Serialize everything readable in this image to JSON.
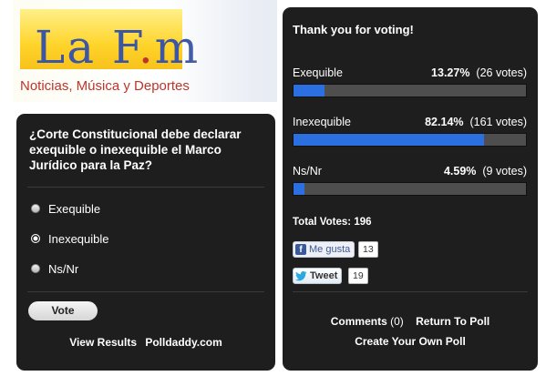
{
  "banner": {
    "logo_main": "La F",
    "logo_dot": ".",
    "logo_end": "m",
    "tagline": "Noticias, Música y Deportes"
  },
  "poll": {
    "question": "¿Corte Constitucional debe declarar exequible o inexequible el Marco Jurídico para la Paz?",
    "options": [
      {
        "label": "Exequible"
      },
      {
        "label": "Inexequible"
      },
      {
        "label": "Ns/Nr"
      }
    ],
    "vote_label": "Vote",
    "view_results_label": "View Results",
    "polldaddy_label": "Polldaddy.com"
  },
  "results": {
    "thanks": "Thank you for voting!",
    "items": [
      {
        "label": "Exequible",
        "percent_text": "13.27%",
        "votes_text": "(26 votes)",
        "percent": 13.27
      },
      {
        "label": "Inexequible",
        "percent_text": "82.14%",
        "votes_text": "(161 votes)",
        "percent": 82.14
      },
      {
        "label": "Ns/Nr",
        "percent_text": "4.59%",
        "votes_text": "(9 votes)",
        "percent": 4.59
      }
    ],
    "total_label": "Total Votes:",
    "total_value": "196",
    "like_label": "Me gusta",
    "like_count": "13",
    "tweet_label": "Tweet",
    "tweet_count": "19",
    "comments_label": "Comments",
    "comments_count": "(0)",
    "return_label": "Return To Poll",
    "create_label": "Create Your Own Poll"
  },
  "colors": {
    "panel_bg": "#1e1e1e",
    "bar_fill": "#2b6fe0",
    "bar_track": "#4e4e4e",
    "logo_blue": "#3c56a4",
    "logo_red": "#c0332b"
  }
}
